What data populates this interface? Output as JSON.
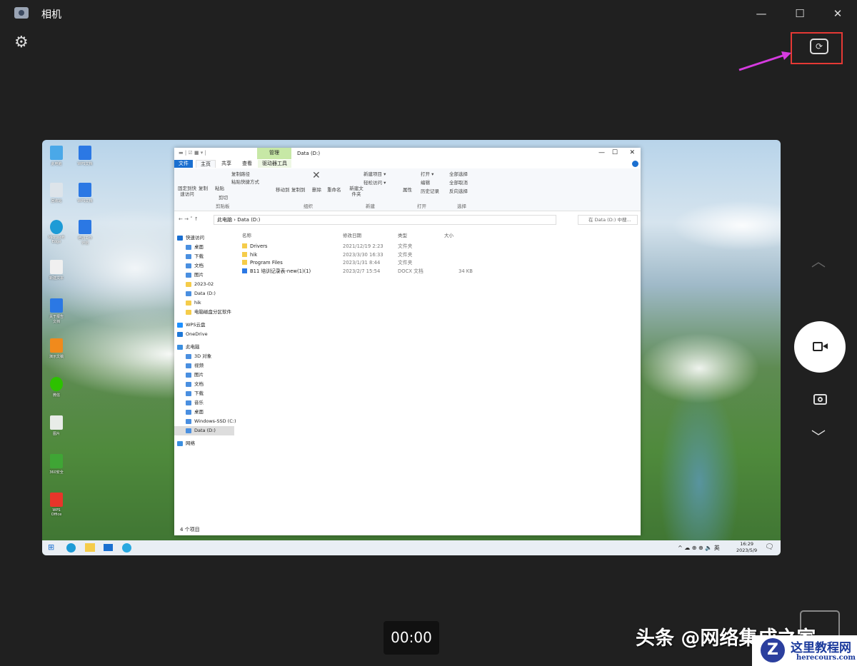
{
  "app": {
    "title": "相机",
    "window_controls": [
      "minimize",
      "maximize",
      "close"
    ]
  },
  "camera": {
    "timer": "00:00",
    "watermark": "头条 @网络集成之家",
    "logo_title": "这里教程网",
    "logo_url": "herecours.com",
    "accent_box_color": "#e53935",
    "arrow_color": "#d63be0"
  },
  "explorer": {
    "title": "Data (D:)",
    "context_tab": "管理",
    "context_tab_sub": "驱动器工具",
    "tabs": [
      "文件",
      "主页",
      "共享",
      "查看"
    ],
    "ribbon": {
      "pin": "固定到快速访问",
      "copy": "复制",
      "paste": "粘贴",
      "copy_path": "复制路径",
      "paste_shortcut": "粘贴快捷方式",
      "cut": "剪切",
      "clipboard": "剪贴板",
      "move_to": "移动到",
      "copy_to": "复制到",
      "delete": "删除",
      "rename": "重命名",
      "organize": "组织",
      "new_folder": "新建文件夹",
      "new_item": "新建项目 ▾",
      "easy_access": "轻松访问 ▾",
      "new": "新建",
      "properties": "属性",
      "open": "打开 ▾",
      "edit": "编辑",
      "history": "历史记录",
      "open_group": "打开",
      "select_all": "全部选择",
      "select_none": "全部取消",
      "invert": "反向选择",
      "select_group": "选择"
    },
    "address": "此电脑 › Data (D:)",
    "search_placeholder": "在 Data (D:) 中搜...",
    "columns": [
      "名称",
      "修改日期",
      "类型",
      "大小"
    ],
    "files": [
      {
        "name": "Drivers",
        "date": "2021/12/19 2:23",
        "type": "文件夹",
        "size": ""
      },
      {
        "name": "hik",
        "date": "2023/3/30 16:33",
        "type": "文件夹",
        "size": ""
      },
      {
        "name": "Program Files",
        "date": "2023/1/31 8:44",
        "type": "文件夹",
        "size": ""
      },
      {
        "name": "B11 培训记录表-new(1)(1)",
        "date": "2023/2/7 15:54",
        "type": "DOCX 文档",
        "size": "34 KB"
      }
    ],
    "nav": [
      "快速访问",
      "桌面",
      "下载",
      "文档",
      "图片",
      "2023-02",
      "Data (D:)",
      "hik",
      "电脑磁盘分区软件",
      "WPS云盘",
      "OneDrive",
      "此电脑",
      "3D 对象",
      "视频",
      "图片",
      "文档",
      "下载",
      "音乐",
      "桌面",
      "Windows-SSD (C:)",
      "Data (D:)",
      "网络"
    ],
    "status": "4 个项目"
  },
  "desktop": {
    "icons": [
      "此电脑",
      "WPS文档",
      "回收站",
      "WPS文档",
      "Microsoft Edge",
      "培训工作计划",
      "新建文本",
      "关于报告文档",
      "演示文稿",
      "微信",
      "图片",
      "360安全",
      "WPS Office"
    ]
  },
  "taskbar": {
    "time": "16:29",
    "date": "2023/5/9",
    "ime": "英"
  }
}
